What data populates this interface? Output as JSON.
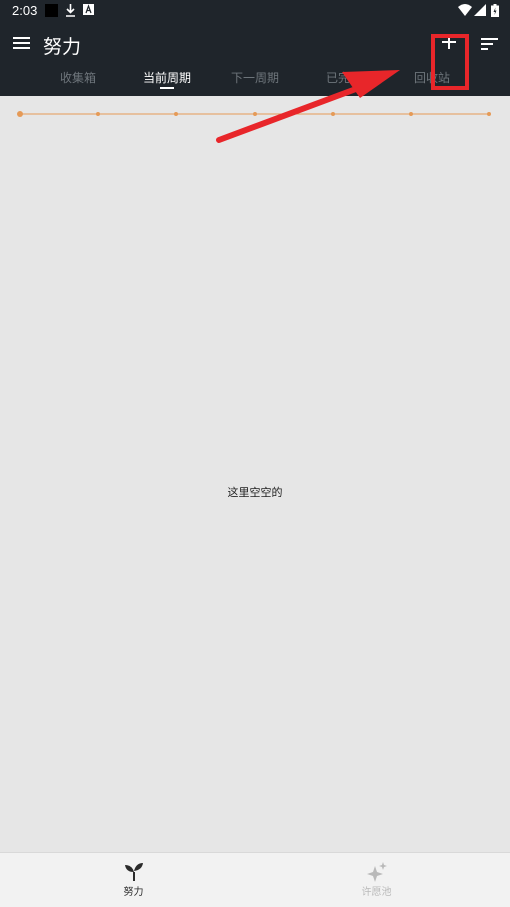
{
  "status_bar": {
    "time": "2:03",
    "icons": [
      "notification-square-icon",
      "download-icon",
      "a-box-icon",
      "wifi-icon",
      "signal-icon",
      "battery-icon"
    ]
  },
  "app_bar": {
    "title": "努力",
    "menu_icon": "menu-icon",
    "add_icon": "add-icon",
    "sort_icon": "sort-icon"
  },
  "tabs": [
    {
      "label": "收集箱",
      "active": false
    },
    {
      "label": "当前周期",
      "active": true
    },
    {
      "label": "下一周期",
      "active": false
    },
    {
      "label": "已完成",
      "active": false
    },
    {
      "label": "回收站",
      "active": false
    }
  ],
  "timeline": {
    "points": 7,
    "accent": "#e59a57"
  },
  "main": {
    "empty_text": "这里空空的"
  },
  "bottom_nav": {
    "items": [
      {
        "label": "努力",
        "icon": "sprout-icon",
        "active": true
      },
      {
        "label": "许愿池",
        "icon": "sparkle-icon",
        "active": false
      }
    ]
  },
  "colors": {
    "app_bar": "#1f252b",
    "background": "#e6e6e6",
    "annotation": "#e8262a",
    "inactive_tab": "#6e757b"
  }
}
